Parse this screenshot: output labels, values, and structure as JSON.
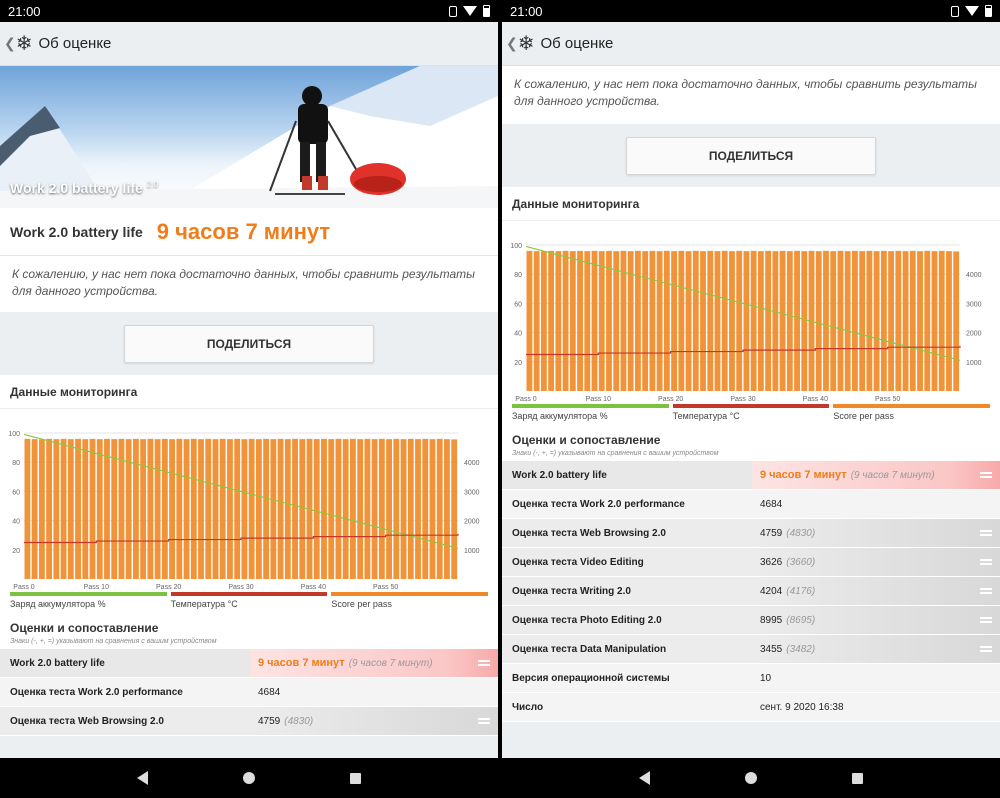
{
  "status": {
    "time": "21:00"
  },
  "appbar": {
    "title": "Об оценке"
  },
  "hero": {
    "title": "Work 2.0 battery life",
    "version": "2.0"
  },
  "result": {
    "label": "Work 2.0 battery life",
    "value": "9 часов 7 минут"
  },
  "note": "К сожалению, у нас нет пока достаточно данных, чтобы сравнить результаты для данного устройства.",
  "share_label": "ПОДЕЛИТЬСЯ",
  "monitoring": {
    "title": "Данные мониторинга"
  },
  "legend": [
    "Заряд аккумулятора %",
    "Температура °C",
    "Score per pass"
  ],
  "legend_colors": [
    "#7cc242",
    "#c0392b",
    "#f08a28"
  ],
  "scores": {
    "title": "Оценки и сопоставление",
    "subtitle": "Знаки (-, +, =) указывают на сравнения с вашим устройством",
    "rows": [
      {
        "label": "Work 2.0 battery life",
        "value": "9 часов 7 минут",
        "ref": "(9 часов 7 минут)"
      },
      {
        "label": "Оценка теста Work 2.0 performance",
        "value": "4684",
        "ref": ""
      },
      {
        "label": "Оценка теста Web Browsing 2.0",
        "value": "4759",
        "ref": "(4830)"
      },
      {
        "label": "Оценка теста Video Editing",
        "value": "3626",
        "ref": "(3660)"
      },
      {
        "label": "Оценка теста Writing 2.0",
        "value": "4204",
        "ref": "(4176)"
      },
      {
        "label": "Оценка теста Photo Editing 2.0",
        "value": "8995",
        "ref": "(8695)"
      },
      {
        "label": "Оценка теста Data Manipulation",
        "value": "3455",
        "ref": "(3482)"
      },
      {
        "label": "Версия операционной системы",
        "value": "10",
        "ref": ""
      },
      {
        "label": "Число",
        "value": "сент. 9 2020 16:38",
        "ref": ""
      }
    ]
  },
  "chart_data": {
    "type": "bar",
    "x_ticks": [
      "Pass 0",
      "Pass 10",
      "Pass 20",
      "Pass 30",
      "Pass 40",
      "Pass 50"
    ],
    "y_left_ticks": [
      "100",
      "80",
      "60",
      "40",
      "20"
    ],
    "y_right_ticks": [
      "4000",
      "3000",
      "2000",
      "1000"
    ],
    "ylim_left": [
      0,
      100
    ],
    "ylim_right": [
      0,
      5000
    ],
    "passes": 60,
    "series": [
      {
        "name": "Score per pass",
        "axis": "right",
        "color": "#f08a28",
        "values": [
          4800,
          4790,
          4780,
          4800,
          4790,
          4800,
          4790,
          4800,
          4790,
          4800,
          4790,
          4800,
          4790,
          4800,
          4790,
          4800,
          4790,
          4800,
          4790,
          4800,
          4790,
          4800,
          4790,
          4800,
          4790,
          4800,
          4790,
          4800,
          4790,
          4800,
          4790,
          4800,
          4790,
          4800,
          4790,
          4800,
          4790,
          4800,
          4790,
          4800,
          4790,
          4800,
          4790,
          4800,
          4790,
          4800,
          4790,
          4800,
          4790,
          4800,
          4790,
          4800,
          4790,
          4800,
          4790,
          4800,
          4790,
          4800,
          4790,
          4780
        ]
      },
      {
        "name": "Заряд аккумулятора %",
        "axis": "left",
        "color": "#8dc63f",
        "start": 99,
        "end": 21
      },
      {
        "name": "Температура °C",
        "axis": "left",
        "color": "#c0392b",
        "start": 25,
        "end": 31
      }
    ]
  }
}
